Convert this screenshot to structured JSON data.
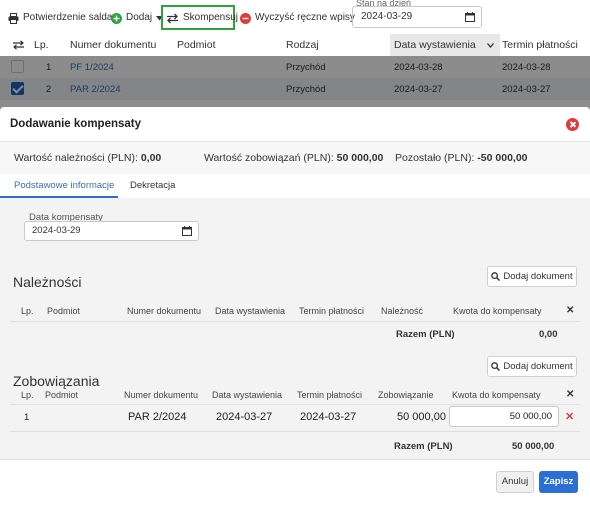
{
  "toolbar": {
    "items": [
      {
        "label": "Potwierdzenie salda",
        "icon": "printer-icon"
      },
      {
        "label": "Dodaj",
        "icon": "plus-circle-icon"
      },
      {
        "label": "Skompensuj",
        "icon": "swap-arrows-icon"
      },
      {
        "label": "Wyczyść ręczne wpisy",
        "icon": "minus-circle-icon"
      }
    ],
    "stan_label": "Stan na dzień",
    "stan_value": "2024-03-29"
  },
  "background_table": {
    "headers": [
      "Lp.",
      "Numer dokumentu",
      "Podmiot",
      "Rodzaj",
      "Data wystawienia",
      "Termin płatności"
    ],
    "rows": [
      {
        "lp": "1",
        "numer": "PF 1/2024",
        "rodzaj": "Przychód",
        "data": "2024-03-28",
        "termin": "2024-03-28",
        "checked": false
      },
      {
        "lp": "2",
        "numer": "PAR 2/2024",
        "rodzaj": "Przychód",
        "data": "2024-03-27",
        "termin": "2024-03-27",
        "checked": true
      }
    ]
  },
  "modal": {
    "title": "Dodawanie kompensaty",
    "summary": {
      "naleznosci_label": "Wartość należności (PLN):",
      "naleznosci_value": "0,00",
      "zobowiazania_label": "Wartość zobowiązań (PLN):",
      "zobowiazania_value": "50 000,00",
      "pozostalo_label": "Pozostało (PLN):",
      "pozostalo_value": "-50 000,00"
    },
    "tabs": [
      "Podstawowe informacje",
      "Dekretacja"
    ],
    "date_label": "Data kompensaty",
    "date_value": "2024-03-29",
    "naleznosci": {
      "title": "Należności",
      "add_label": "Dodaj dokument",
      "headers": [
        "Lp.",
        "Podmiot",
        "Numer dokumentu",
        "Data wystawienia",
        "Termin płatności",
        "Należność",
        "Kwota do kompensaty"
      ],
      "sum_label": "Razem (PLN)",
      "sum_value": "0,00"
    },
    "zobowiazania": {
      "title": "Zobowiązania",
      "add_label": "Dodaj dokument",
      "headers": [
        "Lp.",
        "Podmiot",
        "Numer dokumentu",
        "Data wystawienia",
        "Termin płatności",
        "Zobowiązanie",
        "Kwota do kompensaty"
      ],
      "rows": [
        {
          "lp": "1",
          "podmiot": "",
          "numer": "PAR 2/2024",
          "data": "2024-03-27",
          "termin": "2024-03-27",
          "zobowiazanie": "50 000,00",
          "kwota": "50 000,00"
        }
      ],
      "sum_label": "Razem (PLN)",
      "sum_value": "50 000,00"
    },
    "cancel_label": "Anuluj",
    "save_label": "Zapisz"
  },
  "colors": {
    "accent": "#2b6fd6",
    "highlight_border": "#2ea33a",
    "close_red": "#e03b3b",
    "link": "#3a6fb0"
  }
}
